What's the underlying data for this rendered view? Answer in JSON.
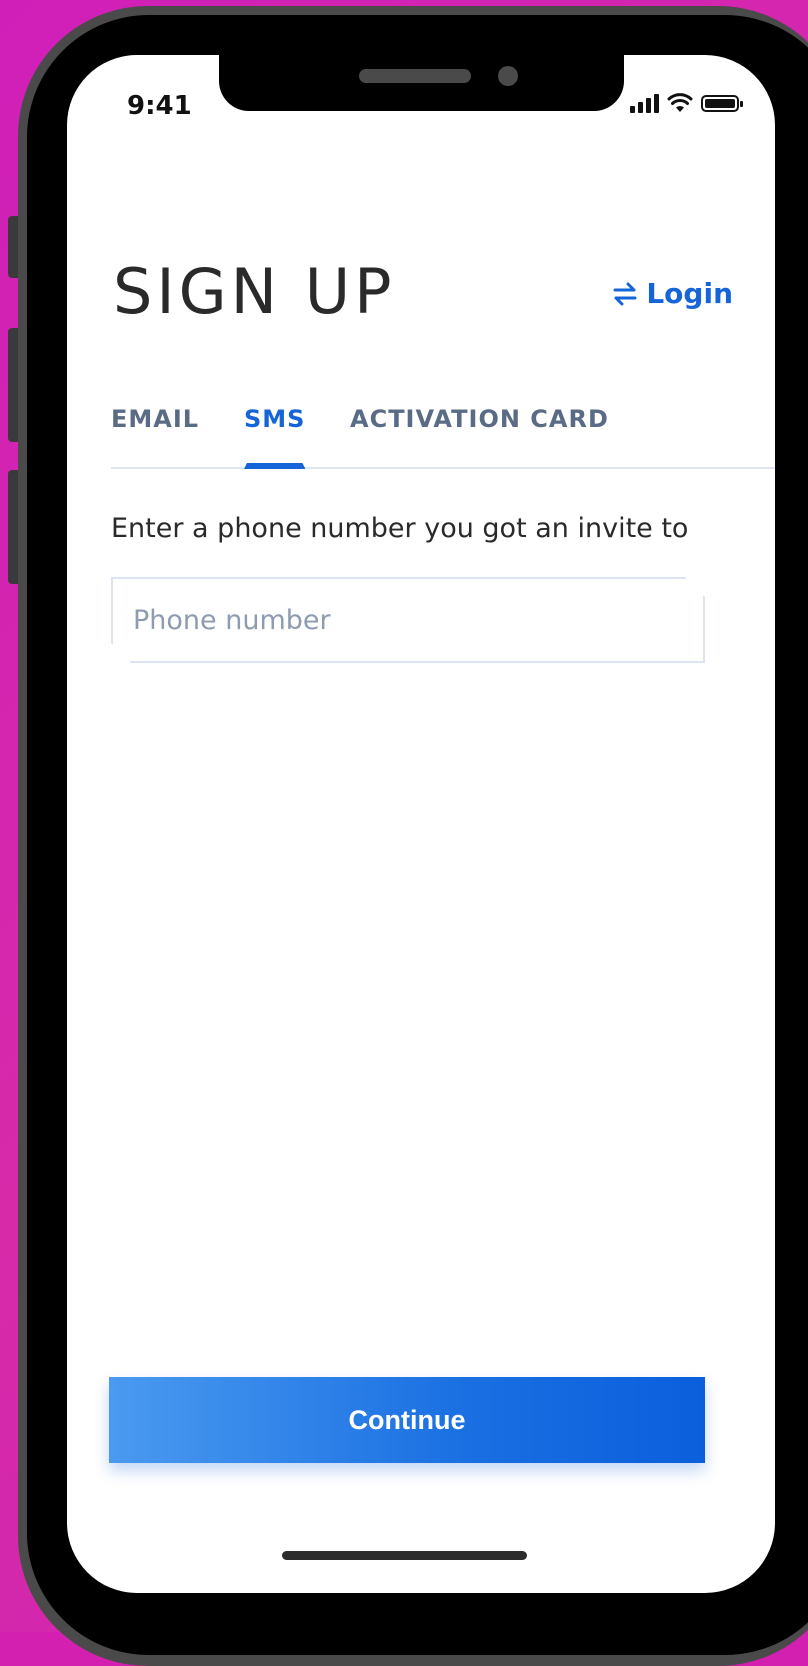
{
  "status_bar": {
    "time": "9:41"
  },
  "header": {
    "title": "SIGN UP",
    "login_label": "Login"
  },
  "tabs": [
    {
      "label": "EMAIL",
      "active": false
    },
    {
      "label": "SMS",
      "active": true
    },
    {
      "label": "ACTIVATION CARD",
      "active": false
    }
  ],
  "form": {
    "prompt": "Enter a phone number you got an invite to",
    "phone_placeholder": "Phone number",
    "phone_value": ""
  },
  "actions": {
    "continue_label": "Continue"
  },
  "colors": {
    "accent": "#1565d8",
    "background": "#d420b0",
    "tab_inactive": "#5a6b85"
  },
  "icons": {
    "login_icon": "swap-arrows-icon"
  }
}
